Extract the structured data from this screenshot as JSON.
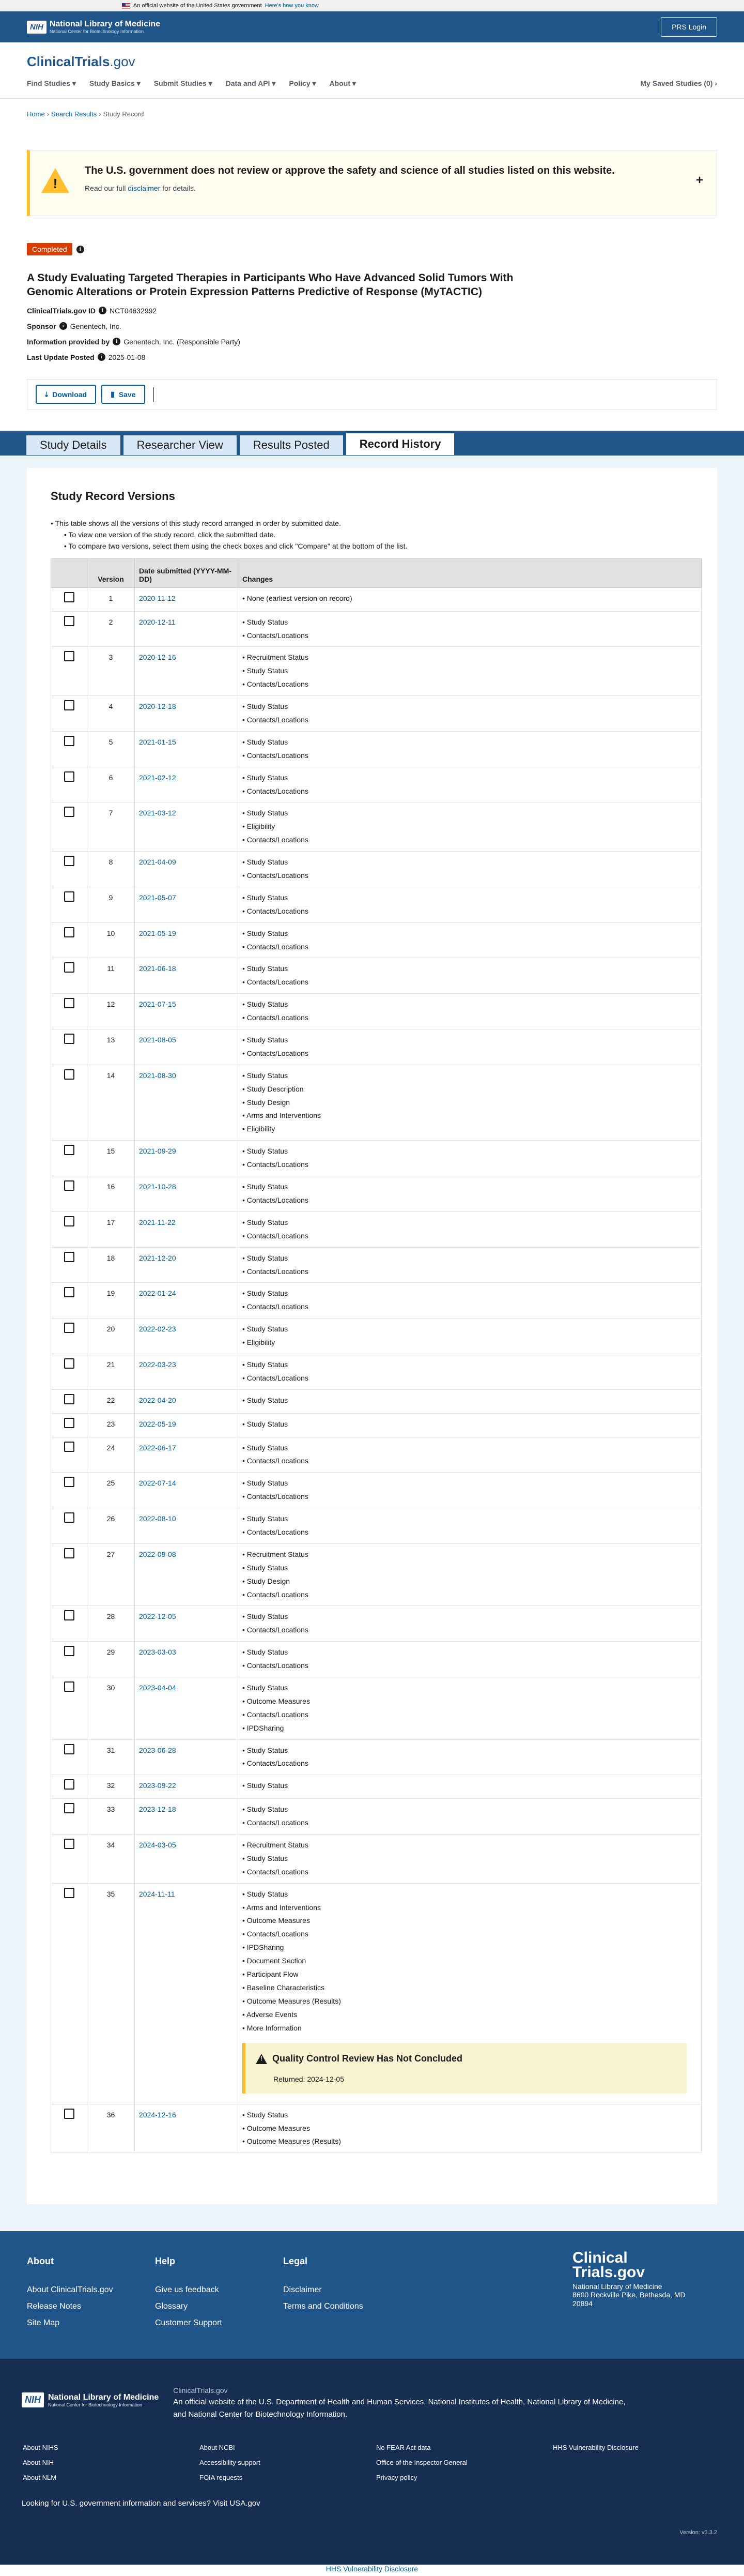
{
  "gov_banner": {
    "text": "An official website of the United States government",
    "link": "Here's how you know"
  },
  "nih": {
    "name": "National Library of Medicine",
    "subname": "National Center for Biotechnology Information",
    "badge": "NIH",
    "prs_button": "PRS Login"
  },
  "site": {
    "logo_main": "ClinicalTrials",
    "logo_suffix": ".gov"
  },
  "nav": {
    "items": [
      "Find Studies",
      "Study Basics",
      "Submit Studies",
      "Data and API",
      "Policy",
      "About"
    ],
    "saved": "My Saved Studies (0)"
  },
  "breadcrumb": {
    "home": "Home",
    "results": "Search Results",
    "current": "Study Record"
  },
  "alert": {
    "title": "The U.S. government does not review or approve the safety and science of all studies listed on this website.",
    "text_pre": "Read our full",
    "link": "disclaimer",
    "text_post": "for details."
  },
  "study": {
    "status": "Completed",
    "title": "A Study Evaluating Targeted Therapies in Participants Who Have Advanced Solid Tumors With Genomic Alterations or Protein Expression Patterns Predictive of Response (MyTACTIC)",
    "id_label": "ClinicalTrials.gov ID",
    "id_value": "NCT04632992",
    "sponsor_label": "Sponsor",
    "sponsor_value": "Genentech, Inc.",
    "info_label": "Information provided by",
    "info_value": "Genentech, Inc. (Responsible Party)",
    "posted_label": "Last Update Posted",
    "posted_value": "2025-01-08"
  },
  "actions": {
    "download": "Download",
    "save": "Save"
  },
  "tabs": [
    "Study Details",
    "Researcher View",
    "Results Posted",
    "Record History"
  ],
  "history": {
    "heading": "Study Record Versions",
    "bullets": [
      "This table shows all the versions of this study record arranged in order by submitted date.",
      "To view one version of the study record, click the submitted date.",
      "To compare two versions, select them using the check boxes and click \"Compare\" at the bottom of the list."
    ],
    "col_version": "Version",
    "col_date": "Date submitted (YYYY-MM-DD)",
    "col_changes": "Changes",
    "rows": [
      {
        "v": "1",
        "d": "2020-11-12",
        "c": [
          "None (earliest version on record)"
        ]
      },
      {
        "v": "2",
        "d": "2020-12-11",
        "c": [
          "Study Status",
          "Contacts/Locations"
        ]
      },
      {
        "v": "3",
        "d": "2020-12-16",
        "c": [
          "Recruitment Status",
          "Study Status",
          "Contacts/Locations"
        ]
      },
      {
        "v": "4",
        "d": "2020-12-18",
        "c": [
          "Study Status",
          "Contacts/Locations"
        ]
      },
      {
        "v": "5",
        "d": "2021-01-15",
        "c": [
          "Study Status",
          "Contacts/Locations"
        ]
      },
      {
        "v": "6",
        "d": "2021-02-12",
        "c": [
          "Study Status",
          "Contacts/Locations"
        ]
      },
      {
        "v": "7",
        "d": "2021-03-12",
        "c": [
          "Study Status",
          "Eligibility",
          "Contacts/Locations"
        ]
      },
      {
        "v": "8",
        "d": "2021-04-09",
        "c": [
          "Study Status",
          "Contacts/Locations"
        ]
      },
      {
        "v": "9",
        "d": "2021-05-07",
        "c": [
          "Study Status",
          "Contacts/Locations"
        ]
      },
      {
        "v": "10",
        "d": "2021-05-19",
        "c": [
          "Study Status",
          "Contacts/Locations"
        ]
      },
      {
        "v": "11",
        "d": "2021-06-18",
        "c": [
          "Study Status",
          "Contacts/Locations"
        ]
      },
      {
        "v": "12",
        "d": "2021-07-15",
        "c": [
          "Study Status",
          "Contacts/Locations"
        ]
      },
      {
        "v": "13",
        "d": "2021-08-05",
        "c": [
          "Study Status",
          "Contacts/Locations"
        ]
      },
      {
        "v": "14",
        "d": "2021-08-30",
        "c": [
          "Study Status",
          "Study Description",
          "Study Design",
          "Arms and Interventions",
          "Eligibility"
        ]
      },
      {
        "v": "15",
        "d": "2021-09-29",
        "c": [
          "Study Status",
          "Contacts/Locations"
        ]
      },
      {
        "v": "16",
        "d": "2021-10-28",
        "c": [
          "Study Status",
          "Contacts/Locations"
        ]
      },
      {
        "v": "17",
        "d": "2021-11-22",
        "c": [
          "Study Status",
          "Contacts/Locations"
        ]
      },
      {
        "v": "18",
        "d": "2021-12-20",
        "c": [
          "Study Status",
          "Contacts/Locations"
        ]
      },
      {
        "v": "19",
        "d": "2022-01-24",
        "c": [
          "Study Status",
          "Contacts/Locations"
        ]
      },
      {
        "v": "20",
        "d": "2022-02-23",
        "c": [
          "Study Status",
          "Eligibility"
        ]
      },
      {
        "v": "21",
        "d": "2022-03-23",
        "c": [
          "Study Status",
          "Contacts/Locations"
        ]
      },
      {
        "v": "22",
        "d": "2022-04-20",
        "c": [
          "Study Status"
        ]
      },
      {
        "v": "23",
        "d": "2022-05-19",
        "c": [
          "Study Status"
        ]
      },
      {
        "v": "24",
        "d": "2022-06-17",
        "c": [
          "Study Status",
          "Contacts/Locations"
        ]
      },
      {
        "v": "25",
        "d": "2022-07-14",
        "c": [
          "Study Status",
          "Contacts/Locations"
        ]
      },
      {
        "v": "26",
        "d": "2022-08-10",
        "c": [
          "Study Status",
          "Contacts/Locations"
        ]
      },
      {
        "v": "27",
        "d": "2022-09-08",
        "c": [
          "Recruitment Status",
          "Study Status",
          "Study Design",
          "Contacts/Locations"
        ]
      },
      {
        "v": "28",
        "d": "2022-12-05",
        "c": [
          "Study Status",
          "Contacts/Locations"
        ]
      },
      {
        "v": "29",
        "d": "2023-03-03",
        "c": [
          "Study Status",
          "Contacts/Locations"
        ]
      },
      {
        "v": "30",
        "d": "2023-04-04",
        "c": [
          "Study Status",
          "Outcome Measures",
          "Contacts/Locations",
          "IPDSharing"
        ]
      },
      {
        "v": "31",
        "d": "2023-06-28",
        "c": [
          "Study Status",
          "Contacts/Locations"
        ]
      },
      {
        "v": "32",
        "d": "2023-09-22",
        "c": [
          "Study Status"
        ]
      },
      {
        "v": "33",
        "d": "2023-12-18",
        "c": [
          "Study Status",
          "Contacts/Locations"
        ]
      },
      {
        "v": "34",
        "d": "2024-03-05",
        "c": [
          "Recruitment Status",
          "Study Status",
          "Contacts/Locations"
        ]
      },
      {
        "v": "35",
        "d": "2024-11-11",
        "c": [
          "Study Status",
          "Arms and Interventions",
          "Outcome Measures",
          "Contacts/Locations",
          "IPDSharing",
          "Document Section",
          "Participant Flow",
          "Baseline Characteristics",
          "Outcome Measures (Results)",
          "Adverse Events",
          "More Information"
        ],
        "qc": {
          "title": "Quality Control Review Has Not Concluded",
          "returned": "Returned: 2024-12-05"
        }
      },
      {
        "v": "36",
        "d": "2024-12-16",
        "c": [
          "Study Status",
          "Outcome Measures",
          "Outcome Measures (Results)"
        ]
      }
    ]
  },
  "footer": {
    "about_h": "About",
    "about_links": [
      "About ClinicalTrials.gov",
      "Release Notes",
      "Site Map"
    ],
    "help_h": "Help",
    "help_links": [
      "Give us feedback",
      "Glossary",
      "Customer Support"
    ],
    "legal_h": "Legal",
    "legal_links": [
      "Disclaimer",
      "Terms and Conditions"
    ],
    "logo_l1": "Clinical",
    "logo_l2": "Trials.gov",
    "addr1": "National Library of Medicine",
    "addr2": "8600 Rockville Pike, Bethesda, MD",
    "addr3": "20894"
  },
  "footer_bottom": {
    "site": "ClinicalTrials.gov",
    "line_pre": "An official website of the",
    "link1": "U.S. Department of Health and Human Services",
    "link2": "National Institutes of Health",
    "link3": "National Library of Medicine",
    "link4": "National Center for Biotechnology Information",
    "col1": [
      "About NIHS",
      "About NIH",
      "About NLM"
    ],
    "col2": [
      "About NCBI",
      "Accessibility support",
      "FOIA requests"
    ],
    "col3": [
      "No FEAR Act data",
      "Office of the Inspector General",
      "Privacy policy"
    ],
    "col4": [
      "HHS Vulnerability Disclosure"
    ],
    "usa_text": "Looking for U.S. government information and services?",
    "usa_link": "Visit USA.gov",
    "version": "Version: v3.3.2"
  },
  "vuln": "HHS Vulnerability Disclosure"
}
